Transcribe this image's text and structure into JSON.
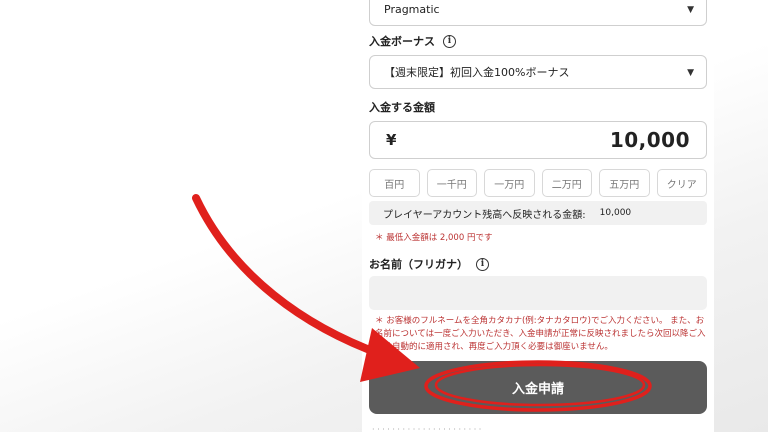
{
  "provider_select": {
    "value": "Pragmatic"
  },
  "bonus": {
    "label": "入金ボーナス",
    "value": "【週末限定】初回入金100%ボーナス"
  },
  "amount": {
    "label": "入金する金額",
    "currency": "¥",
    "value": "10,000"
  },
  "quick_buttons": [
    "百円",
    "一千円",
    "一万円",
    "二万円",
    "五万円",
    "クリア"
  ],
  "reflect": {
    "label": "プレイヤーアカウント残高へ反映される金額:",
    "value": "10,000"
  },
  "min_note": "＊ 最低入金額は 2,000 円です",
  "name": {
    "label": "お名前（フリガナ）",
    "placeholder": ""
  },
  "notice": "＊ お客様のフルネームを全角カタカナ(例:タナカタロウ)でご入力ください。 また、お名前については一度ご入力いただき、入金申請が正常に反映されましたら次回以降ご入金は自動的に適用され、再度ご入力頂く必要は御座いません。",
  "submit_label": "入金申請",
  "colors": {
    "annotation_red": "#e0201c",
    "submit_bg": "#5b5b5b"
  }
}
